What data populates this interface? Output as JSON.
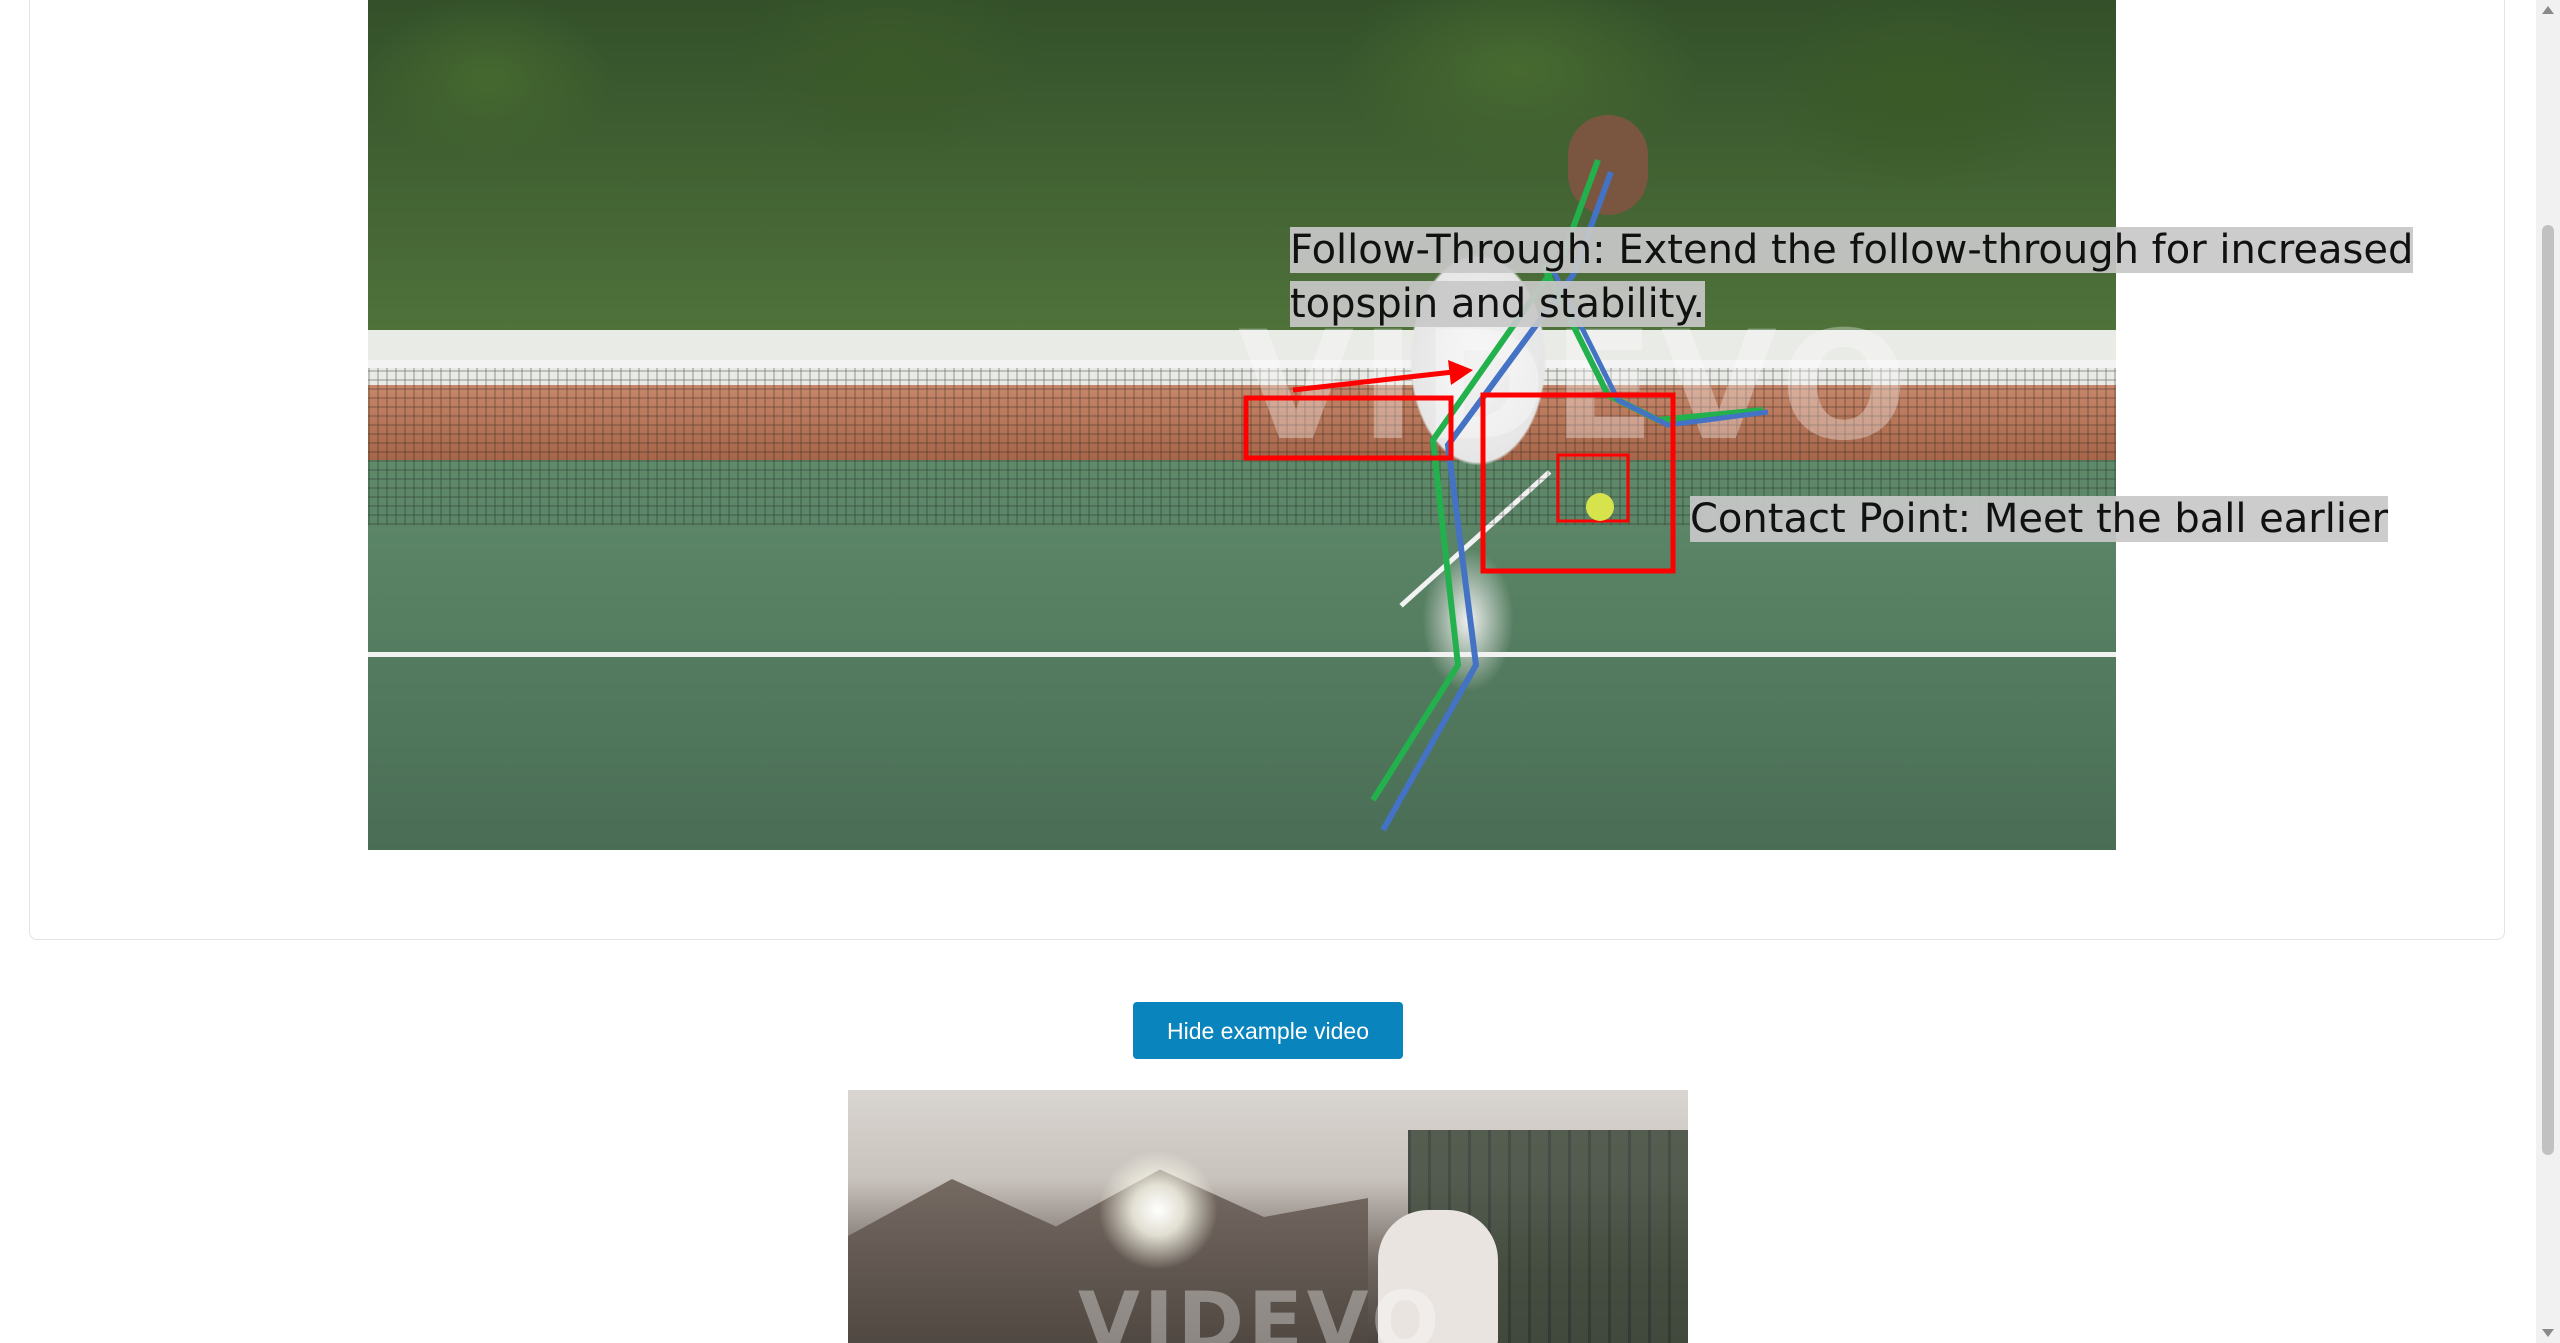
{
  "analysis_video": {
    "watermark": "VIDEVO",
    "annotations": {
      "follow_through": "Follow-Through: Extend the follow-through for increased topspin and stability.",
      "contact_point": "Contact Point: Meet the ball earlier"
    },
    "colors": {
      "pose_user": "#22b14c",
      "pose_reference": "#4472c4",
      "highlight": "#ff0000"
    }
  },
  "toggle_button": {
    "label": "Hide example video"
  },
  "example_video": {
    "watermark": "VIDEVO"
  },
  "colors": {
    "button_bg": "#0a84bd",
    "card_border": "#e3e3e3"
  }
}
